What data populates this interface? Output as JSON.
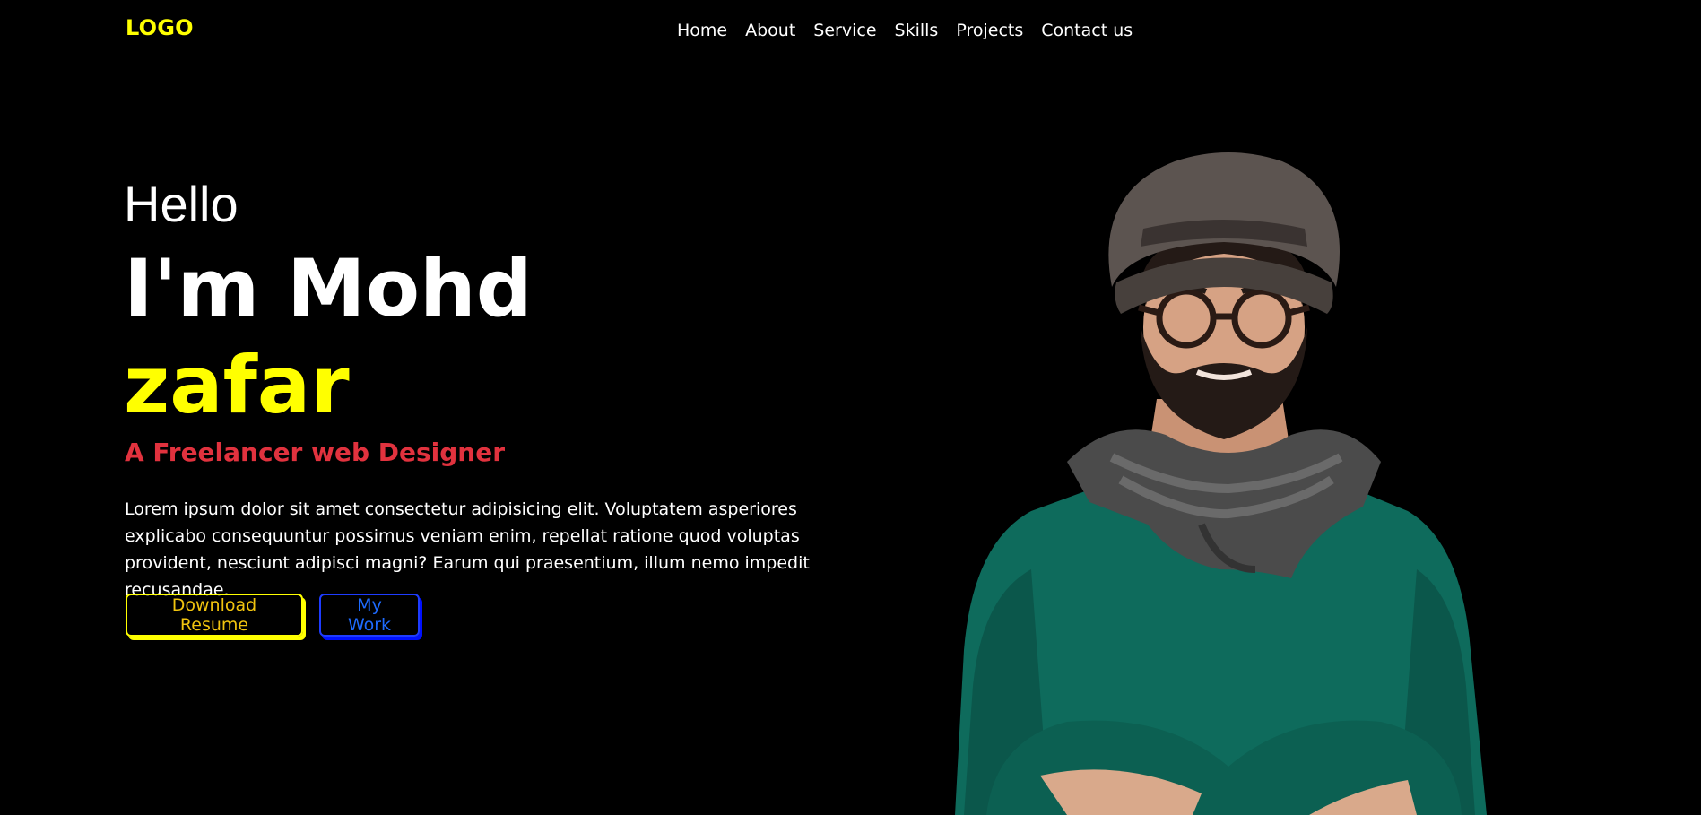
{
  "header": {
    "logo": "LOGO",
    "nav": [
      "Home",
      "About",
      "Service",
      "Skills",
      "Projects",
      "Contact us"
    ]
  },
  "hero": {
    "greeting": "Hello",
    "name_line": "I'm Mohd",
    "name_highlight": "zafar",
    "subtitle": "A Freelancer web Designer",
    "description": "Lorem ipsum dolor sit amet consectetur adipisicing elit. Voluptatem asperiores explicabo consequuntur possimus veniam enim, repellat ratione quod voluptas provident, nesciunt adipisci magni? Earum qui praesentium, illum nemo impedit recusandae.",
    "buttons": {
      "resume": "Download Resume",
      "work": "My Work"
    }
  },
  "colors": {
    "background": "#000000",
    "accent_yellow": "#ffff00",
    "subtitle_red": "#e1323e",
    "work_blue": "#1e3cff",
    "sweater_green": "#0e6b5c"
  }
}
